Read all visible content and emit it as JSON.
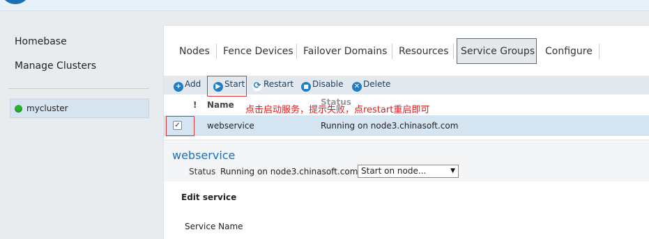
{
  "sidebar": {
    "items": [
      {
        "label": "Homebase"
      },
      {
        "label": "Manage Clusters"
      }
    ],
    "cluster": {
      "label": "mycluster",
      "status_color": "#28b32d"
    }
  },
  "tabs": [
    {
      "label": "Nodes"
    },
    {
      "label": "Fence Devices"
    },
    {
      "label": "Failover Domains"
    },
    {
      "label": "Resources"
    },
    {
      "label": "Service Groups",
      "active": true
    },
    {
      "label": "Configure"
    }
  ],
  "toolbar": {
    "add": "Add",
    "start": "Start",
    "restart": "Restart",
    "disable": "Disable",
    "delete": "Delete"
  },
  "table": {
    "headers": {
      "flag": "!",
      "name": "Name",
      "status": "Status"
    },
    "rows": [
      {
        "checked": true,
        "name": "webservice",
        "status": "Running on node3.chinasoft.com"
      }
    ]
  },
  "annotation": "点击启动服务，提示失败，点restart重启即可",
  "detail": {
    "title": "webservice",
    "status_label": "Status",
    "status_value": "Running on node3.chinasoft.com",
    "start_select": "Start on node...",
    "edit_heading": "Edit service",
    "field_service_name": "Service Name"
  },
  "colors": {
    "accent": "#1e6fb5",
    "highlight": "#dd3333",
    "annotation": "#e01b1b"
  }
}
